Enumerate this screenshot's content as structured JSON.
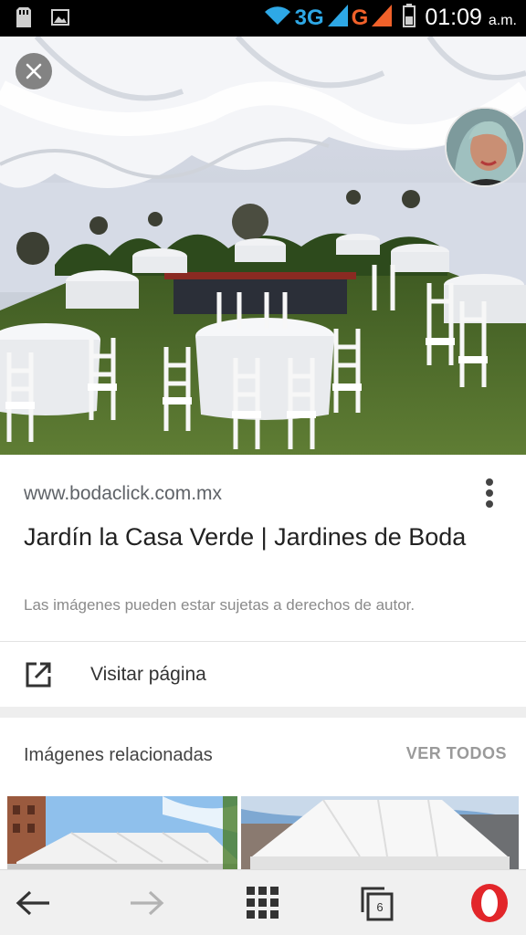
{
  "status_bar": {
    "network1": "3G",
    "network2": "G",
    "time": "01:09",
    "ampm": "a.m.",
    "icons": [
      "sd-card-icon",
      "image-icon",
      "wifi-icon",
      "signal-icon",
      "battery-icon"
    ]
  },
  "hero": {
    "close_icon": "close-icon",
    "avatar_icon": "avatar"
  },
  "result": {
    "domain": "www.bodaclick.com.mx",
    "title": "Jardín la Casa Verde | Jardines de Boda",
    "copyright_note": "Las imágenes pueden estar sujetas a derechos de autor.",
    "visit_label": "Visitar página"
  },
  "related": {
    "title": "Imágenes relacionadas",
    "see_all": "VER TODOS"
  },
  "bottom_nav": {
    "tabs_count": "6",
    "icons": [
      "back-icon",
      "forward-icon",
      "speed-dial-icon",
      "tabs-icon",
      "opera-icon"
    ]
  },
  "colors": {
    "accent_blue": "#2ea8e6",
    "accent_orange": "#f0612a",
    "opera_red": "#e2262a"
  }
}
